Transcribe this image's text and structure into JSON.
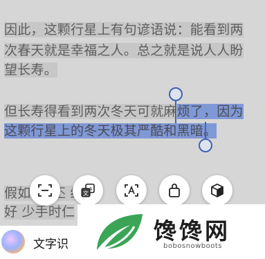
{
  "text": {
    "line1": "因此，这颗行星上有句谚语说：能看到两",
    "line2": "次春天就是幸福之人。总之就是说人人盼",
    "line3": "望长寿。",
    "line4_plain": "但长寿得看到两次冬天可就麻",
    "line4_selected": "烦了，因为",
    "line5_selected": "这颗行星上的冬天极其严酷和黑暗。",
    "line6": "假如    在          丕          给为",
    "line7": "好   少手时仁"
  },
  "toolbar": {
    "items": [
      {
        "name": "scan-icon"
      },
      {
        "name": "translate-icon"
      },
      {
        "name": "text-recognition-icon"
      },
      {
        "name": "shopping-bag-icon"
      },
      {
        "name": "3d-box-icon"
      }
    ]
  },
  "assistant": {
    "label": "文字识"
  },
  "watermark": {
    "title": "馋馋网",
    "subtitle": "bobosnowboots",
    "brand_color": "#2e9d4a"
  },
  "colors": {
    "selection": "#7f98d6",
    "handle": "#3f63b6",
    "background": "#d6d6d6"
  }
}
